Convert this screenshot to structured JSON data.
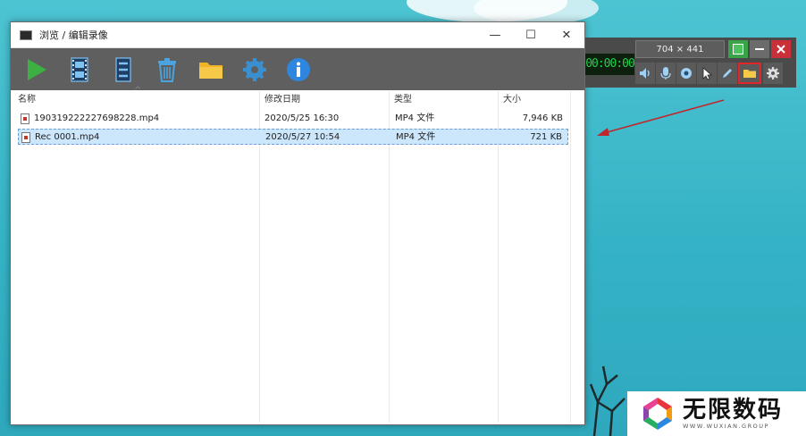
{
  "window": {
    "title": "浏览 / 编辑录像",
    "controls": {
      "minimize": "—",
      "maximize": "☐",
      "close": "✕"
    }
  },
  "toolbar": {
    "buttons": [
      {
        "icon": "play-icon",
        "color": "#3cb043"
      },
      {
        "icon": "film-edit-icon",
        "color": "#3a8fd1"
      },
      {
        "icon": "film-convert-icon",
        "color": "#3a8fd1"
      },
      {
        "icon": "trash-icon",
        "color": "#4aa3df"
      },
      {
        "icon": "folder-icon",
        "color": "#f0b429"
      },
      {
        "icon": "gear-icon",
        "color": "#3a8fd1"
      },
      {
        "icon": "info-icon",
        "color": "#2e86de"
      }
    ]
  },
  "list": {
    "columns": [
      "名称",
      "修改日期",
      "类型",
      "大小"
    ],
    "sort_indicator": "^",
    "rows": [
      {
        "name": "190319222227698228.mp4",
        "date": "2020/5/25 16:30",
        "type": "MP4 文件",
        "size": "7,946 KB",
        "selected": false
      },
      {
        "name": "Rec 0001.mp4",
        "date": "2020/5/27 10:54",
        "type": "MP4 文件",
        "size": "721 KB",
        "selected": true
      }
    ]
  },
  "recorder_panel": {
    "counter": "00:00:00",
    "dimensions": "704 × 441",
    "top_buttons": [
      "record-icon",
      "minimize-icon",
      "close-icon"
    ],
    "tools": [
      "speaker-icon",
      "microphone-icon",
      "webcam-icon",
      "cursor-icon",
      "pencil-icon",
      "folder-icon",
      "gear-icon"
    ],
    "highlighted_tool": "folder-icon"
  },
  "watermark": {
    "name": "无限数码",
    "subtitle": "WWW.WUXIAN.GROUP"
  }
}
